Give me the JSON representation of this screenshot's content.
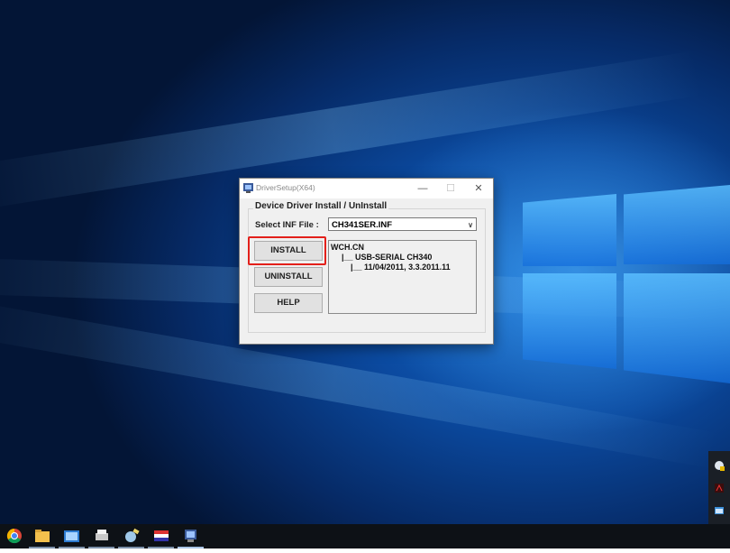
{
  "window": {
    "title": "DriverSetup(X64)",
    "controls": {
      "minimize": "—",
      "maximize": "☐",
      "close": "✕"
    }
  },
  "dialog": {
    "group_title": "Device Driver Install / UnInstall",
    "inf_label": "Select INF File :",
    "inf_value": "CH341SER.INF",
    "buttons": {
      "install": "INSTALL",
      "uninstall": "UNINSTALL",
      "help": "HELP"
    },
    "info_lines": [
      "WCH.CN",
      "|__ USB-SERIAL CH340",
      "|__ 11/04/2011, 3.3.2011.11"
    ]
  },
  "colors": {
    "highlight": "#e3201b",
    "desktop": "#0b4aa0",
    "taskbar": "#0d1116"
  },
  "taskbar": {
    "icons": [
      "chrome-icon",
      "file-explorer-icon",
      "photos-icon",
      "printer-icon",
      "satellite-icon",
      "flag-icon",
      "driver-setup-icon"
    ]
  },
  "tray": {
    "icons": [
      "tray-app-icon",
      "tray-pdf-icon",
      "tray-window-icon"
    ]
  }
}
